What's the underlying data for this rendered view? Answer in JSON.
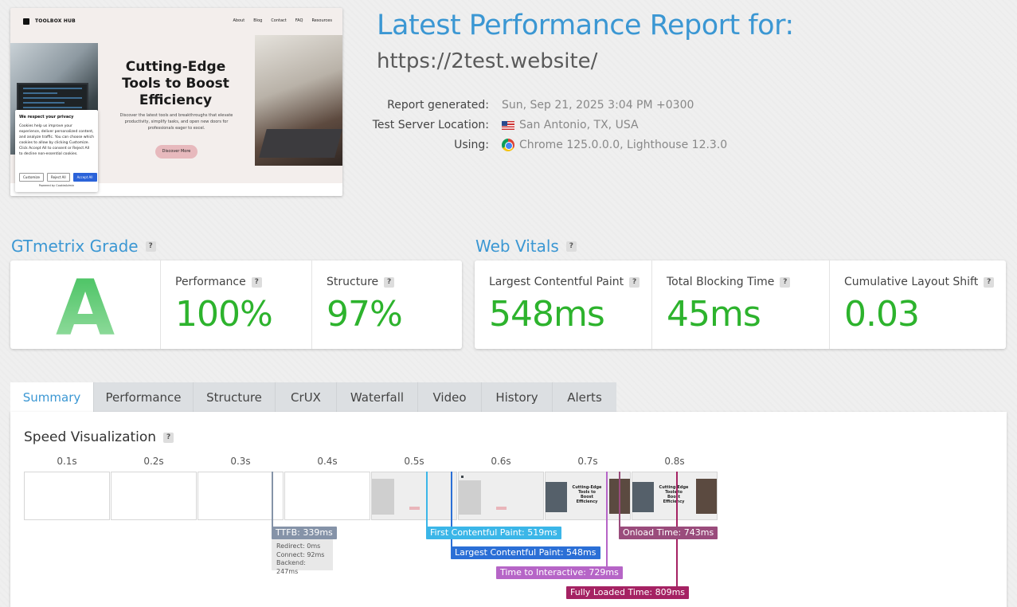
{
  "report": {
    "title": "Latest Performance Report for:",
    "url": "https://2test.website/",
    "generated_label": "Report generated:",
    "generated_value": "Sun, Sep 21, 2025 3:04 PM +0300",
    "location_label": "Test Server Location:",
    "location_value": "San Antonio, TX, USA",
    "using_label": "Using:",
    "using_value": "Chrome 125.0.0.0, Lighthouse 12.3.0"
  },
  "thumbnail": {
    "brand": "TOOLBOX HUB",
    "nav": [
      "About",
      "Blog",
      "Contact",
      "FAQ",
      "Resources"
    ],
    "hero_title": "Cutting-Edge Tools to Boost Efficiency",
    "hero_text": "Discover the latest tools and breakthroughs that elevate productivity, simplify tasks, and open new doors for professionals eager to excel.",
    "hero_button": "Discover More",
    "cookie_title": "We respect your privacy",
    "cookie_text": "Cookies help us improve your experience, deliver personalized content, and analyze traffic. You can choose which cookies to allow by clicking Customize. Click Accept All to consent or Reject All to decline non-essential cookies.",
    "cookie_customize": "Customize",
    "cookie_reject": "Reject All",
    "cookie_accept": "Accept All",
    "cookie_powered": "Powered by CookieAdmin"
  },
  "grade": {
    "heading": "GTmetrix Grade",
    "letter": "A",
    "performance_label": "Performance",
    "performance_value": "100%",
    "structure_label": "Structure",
    "structure_value": "97%"
  },
  "vitals": {
    "heading": "Web Vitals",
    "lcp_label": "Largest Contentful Paint",
    "lcp_value": "548ms",
    "tbt_label": "Total Blocking Time",
    "tbt_value": "45ms",
    "cls_label": "Cumulative Layout Shift",
    "cls_value": "0.03"
  },
  "tabs": [
    "Summary",
    "Performance",
    "Structure",
    "CrUX",
    "Waterfall",
    "Video",
    "History",
    "Alerts"
  ],
  "speed": {
    "heading": "Speed Visualization",
    "times": [
      "0.1s",
      "0.2s",
      "0.3s",
      "0.4s",
      "0.5s",
      "0.6s",
      "0.7s",
      "0.8s"
    ],
    "ttfb": "TTFB: 339ms",
    "ttfb_redirect": "Redirect: 0ms",
    "ttfb_connect": "Connect: 92ms",
    "ttfb_backend": "Backend: 247ms",
    "fcp": "First Contentful Paint: 519ms",
    "lcp": "Largest Contentful Paint: 548ms",
    "tti": "Time to Interactive: 729ms",
    "onload": "Onload Time: 743ms",
    "fully_loaded": "Fully Loaded Time: 809ms"
  },
  "colors": {
    "accent": "#3b97d3",
    "good": "#2db32d",
    "ttfb": "#8593a8",
    "fcp": "#3bb6e8",
    "lcp": "#2b6fd6",
    "tti": "#b665c7",
    "onload": "#9a4c7c",
    "fully_loaded": "#a52263"
  },
  "icons": {
    "help": "question-icon",
    "flag": "us-flag-icon",
    "browser": "chrome-icon"
  }
}
